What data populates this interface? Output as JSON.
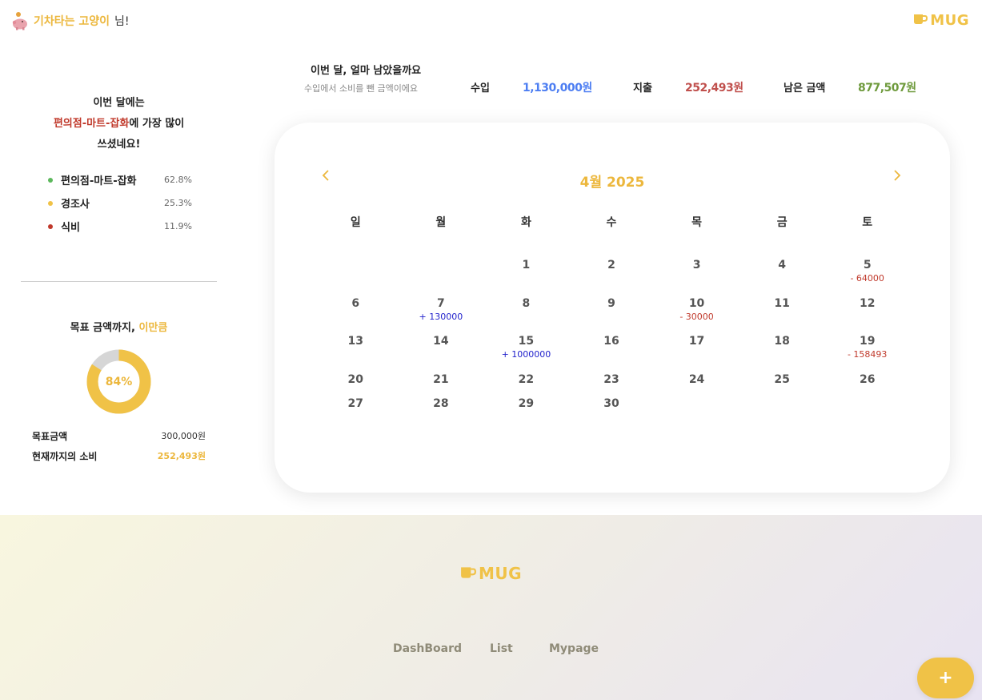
{
  "header": {
    "user_name": "기차타는 고양이",
    "user_suffix": " 님!",
    "logo_text": "MUG"
  },
  "summary": {
    "title": "이번 달, 얼마 남았을까요",
    "subtitle": "수입에서 소비를 뺀 금액이에요",
    "income_label": "수입",
    "income_value": "1,130,000원",
    "expense_label": "지출",
    "expense_value": "252,493원",
    "remaining_label": "남은 금액",
    "remaining_value": "877,507원",
    "colors": {
      "income": "#4d7ef2",
      "expense": "#c0504d",
      "remaining": "#6e9a3c"
    }
  },
  "spending": {
    "line1": "이번 달에는",
    "highlight": "편의점-마트-잡화",
    "line2_rest": "에 가장 많이",
    "line3": "쓰셨네요!",
    "categories": [
      {
        "name": "편의점-마트-잡화",
        "pct": "62.8%",
        "color": "#5cb85c"
      },
      {
        "name": "경조사",
        "pct": "25.3%",
        "color": "#f0c247"
      },
      {
        "name": "식비",
        "pct": "11.9%",
        "color": "#c0392b"
      }
    ]
  },
  "goal": {
    "title": "목표 금액까지, ",
    "title_highlight": "이만큼",
    "percent": 84,
    "percent_label": "84%",
    "target_label": "목표금액",
    "target_value": "300,000원",
    "spent_label": "현재까지의 소비",
    "spent_value": "252,493원"
  },
  "calendar": {
    "title": "4월 2025",
    "prev_icon": "chevron-left-icon",
    "next_icon": "chevron-right-icon",
    "weekdays": [
      "일",
      "월",
      "화",
      "수",
      "목",
      "금",
      "토"
    ],
    "leading_blanks": 2,
    "days": [
      {
        "d": "1"
      },
      {
        "d": "2"
      },
      {
        "d": "3"
      },
      {
        "d": "4"
      },
      {
        "d": "5",
        "amt": "- 64000",
        "type": "minus"
      },
      {
        "d": "6"
      },
      {
        "d": "7",
        "amt": "+ 130000",
        "type": "plus"
      },
      {
        "d": "8"
      },
      {
        "d": "9"
      },
      {
        "d": "10",
        "amt": "- 30000",
        "type": "minus"
      },
      {
        "d": "11"
      },
      {
        "d": "12"
      },
      {
        "d": "13"
      },
      {
        "d": "14"
      },
      {
        "d": "15",
        "amt": "+ 1000000",
        "type": "plus"
      },
      {
        "d": "16"
      },
      {
        "d": "17"
      },
      {
        "d": "18"
      },
      {
        "d": "19",
        "amt": "- 158493",
        "type": "minus"
      },
      {
        "d": "20"
      },
      {
        "d": "21"
      },
      {
        "d": "22"
      },
      {
        "d": "23"
      },
      {
        "d": "24"
      },
      {
        "d": "25"
      },
      {
        "d": "26"
      },
      {
        "d": "27"
      },
      {
        "d": "28"
      },
      {
        "d": "29"
      },
      {
        "d": "30"
      }
    ]
  },
  "footer": {
    "logo_text": "MUG",
    "nav": [
      "DashBoard",
      "List",
      "Mypage"
    ]
  },
  "fab": {
    "label": "+",
    "icon": "plus-icon"
  }
}
